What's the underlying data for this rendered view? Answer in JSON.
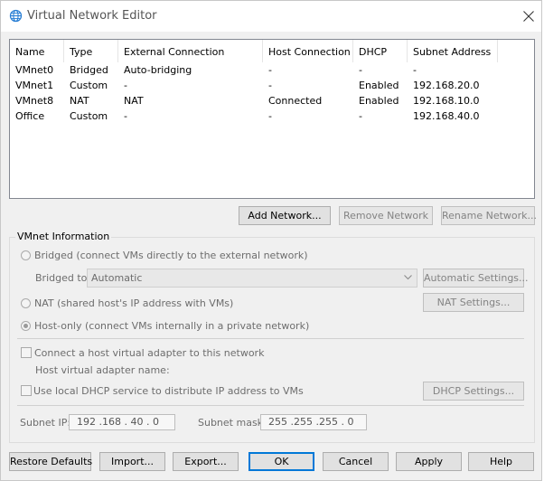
{
  "window": {
    "title": "Virtual Network Editor",
    "icon": "network-globe-icon",
    "close_icon": "close-icon"
  },
  "table": {
    "columns": [
      "Name",
      "Type",
      "External Connection",
      "Host Connection",
      "DHCP",
      "Subnet Address"
    ],
    "rows": [
      [
        "VMnet0",
        "Bridged",
        "Auto-bridging",
        "-",
        "-",
        "-"
      ],
      [
        "VMnet1",
        "Custom",
        "-",
        "-",
        "Enabled",
        "192.168.20.0"
      ],
      [
        "VMnet8",
        "NAT",
        "NAT",
        "Connected",
        "Enabled",
        "192.168.10.0"
      ],
      [
        "Office",
        "Custom",
        "-",
        "-",
        "-",
        "192.168.40.0"
      ]
    ]
  },
  "table_buttons": {
    "add": "Add Network...",
    "remove": "Remove Network",
    "rename": "Rename Network..."
  },
  "vmnet_info": {
    "group_label": "VMnet Information",
    "bridged_label": "Bridged (connect VMs directly to the external network)",
    "bridged_to_label": "Bridged to:",
    "bridged_to_value": "Automatic",
    "auto_settings_button": "Automatic Settings...",
    "nat_label": "NAT (shared host's IP address with VMs)",
    "nat_settings_button": "NAT Settings...",
    "hostonly_label": "Host-only (connect VMs internally in a private network)",
    "selected_mode": "host-only",
    "connect_adapter_label": "Connect a host virtual adapter to this network",
    "adapter_name_label": "Host virtual adapter name:",
    "dhcp_label": "Use local DHCP service to distribute IP address to VMs",
    "dhcp_settings_button": "DHCP Settings...",
    "subnet_ip_label": "Subnet IP:",
    "subnet_ip_value": "192 .168 . 40 .  0",
    "subnet_mask_label": "Subnet mask:",
    "subnet_mask_value": "255 .255 .255 .  0"
  },
  "bottom_buttons": {
    "restore": "Restore Defaults",
    "import": "Import...",
    "export": "Export...",
    "ok": "OK",
    "cancel": "Cancel",
    "apply": "Apply",
    "help": "Help"
  },
  "colors": {
    "title_text": "#555555",
    "default_button_border": "#0078d7",
    "disabled_text": "#838383"
  }
}
